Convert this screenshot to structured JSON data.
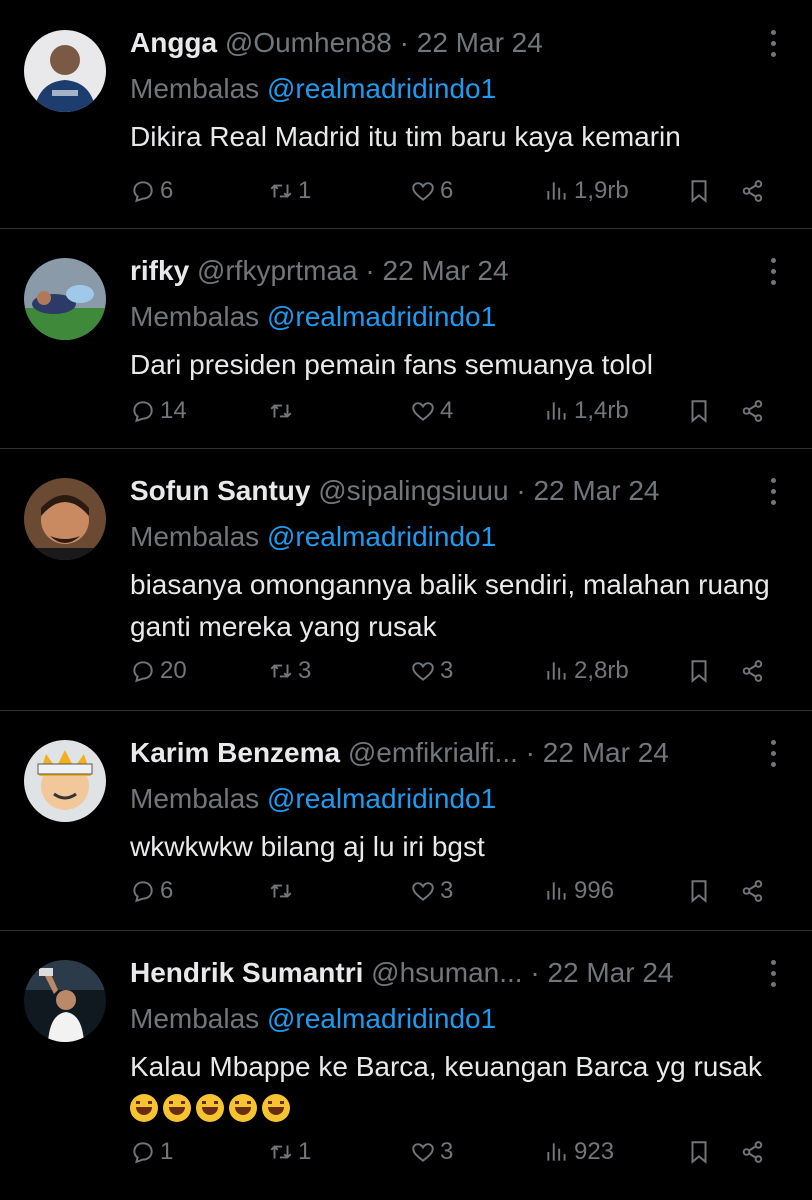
{
  "tweets": [
    {
      "name": "Angga",
      "handle": "@Oumhen88",
      "separator": "·",
      "date": "22 Mar 24",
      "reply_prefix": "Membalas",
      "reply_to": "@realmadridindo1",
      "text": "Dikira Real Madrid itu tim baru kaya kemarin",
      "replies": "6",
      "retweets": "1",
      "likes": "6",
      "views": "1,9rb"
    },
    {
      "name": "rifky",
      "handle": "@rfkyprtmaa",
      "separator": "·",
      "date": "22 Mar 24",
      "reply_prefix": "Membalas",
      "reply_to": "@realmadridindo1",
      "text": "Dari presiden pemain fans semuanya tolol",
      "replies": "14",
      "retweets": "",
      "likes": "4",
      "views": "1,4rb"
    },
    {
      "name": "Sofun Santuy",
      "handle": "@sipalingsiuuu",
      "separator": "·",
      "date": "22 Mar 24",
      "reply_prefix": "Membalas",
      "reply_to": "@realmadridindo1",
      "text": "biasanya omongannya balik sendiri, malahan ruang ganti mereka yang rusak",
      "replies": "20",
      "retweets": "3",
      "likes": "3",
      "views": "2,8rb"
    },
    {
      "name": "Karim Benzema",
      "handle": "@emfikrialfi...",
      "separator": "·",
      "date": "22 Mar 24",
      "reply_prefix": "Membalas",
      "reply_to": "@realmadridindo1",
      "text": "wkwkwkw bilang aj lu iri bgst",
      "replies": "6",
      "retweets": "",
      "likes": "3",
      "views": "996"
    },
    {
      "name": "Hendrik Sumantri",
      "handle": "@hsuman...",
      "separator": "·",
      "date": "22 Mar 24",
      "reply_prefix": "Membalas",
      "reply_to": "@realmadridindo1",
      "text": "Kalau Mbappe ke Barca, keuangan Barca yg rusak",
      "emoji_count": 5,
      "replies": "1",
      "retweets": "1",
      "likes": "3",
      "views": "923"
    }
  ],
  "icons": {
    "reply": "comment-bubble-icon",
    "retweet": "retweet-arrows-icon",
    "like": "heart-icon",
    "views": "bar-chart-icon",
    "bookmark": "bookmark-icon",
    "share": "share-icon",
    "more": "more-vertical-icon",
    "emoji": "rolling-on-floor-laughing-emoji"
  },
  "colors": {
    "background": "#000000",
    "text": "#e7e9ea",
    "muted": "#71767b",
    "link": "#1d9bf0",
    "divider": "#2f3336"
  }
}
